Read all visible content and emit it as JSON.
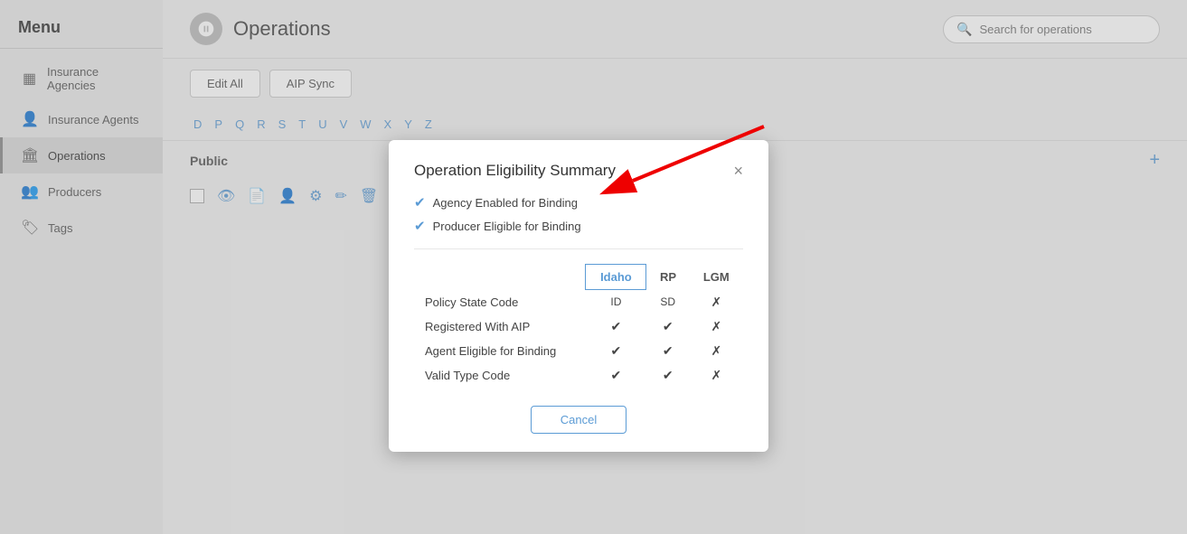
{
  "sidebar": {
    "title": "Menu",
    "items": [
      {
        "id": "insurance-agencies",
        "label": "Insurance Agencies",
        "icon": "▦"
      },
      {
        "id": "insurance-agents",
        "label": "Insurance Agents",
        "icon": "👤"
      },
      {
        "id": "operations",
        "label": "Operations",
        "icon": "🏛",
        "active": true
      },
      {
        "id": "producers",
        "label": "Producers",
        "icon": "👥"
      },
      {
        "id": "tags",
        "label": "Tags",
        "icon": "🏷"
      }
    ]
  },
  "header": {
    "title": "Operations",
    "search_placeholder": "Search for operations"
  },
  "toolbar": {
    "edit_all_label": "Edit All",
    "aip_sync_label": "AIP Sync"
  },
  "alphabet": [
    "D",
    "P",
    "Q",
    "R",
    "S",
    "T",
    "U",
    "V",
    "W",
    "X",
    "Y",
    "Z"
  ],
  "table": {
    "public_label": "Public"
  },
  "modal": {
    "title": "Operation Eligibility Summary",
    "close_label": "×",
    "checks": [
      {
        "label": "Agency Enabled for Binding"
      },
      {
        "label": "Producer Eligible for Binding"
      }
    ],
    "columns": [
      "Idaho",
      "RP",
      "LGM"
    ],
    "rows": [
      {
        "label": "Policy State Code",
        "idaho": "ID",
        "rp": "SD",
        "lgm": "✗"
      },
      {
        "label": "Registered With AIP",
        "idaho": "✓",
        "rp": "✓",
        "lgm": "✗"
      },
      {
        "label": "Agent Eligible for Binding",
        "idaho": "✓",
        "rp": "✓",
        "lgm": "✗"
      },
      {
        "label": "Valid Type Code",
        "idaho": "✓",
        "rp": "✓",
        "lgm": "✗"
      }
    ],
    "cancel_label": "Cancel"
  }
}
